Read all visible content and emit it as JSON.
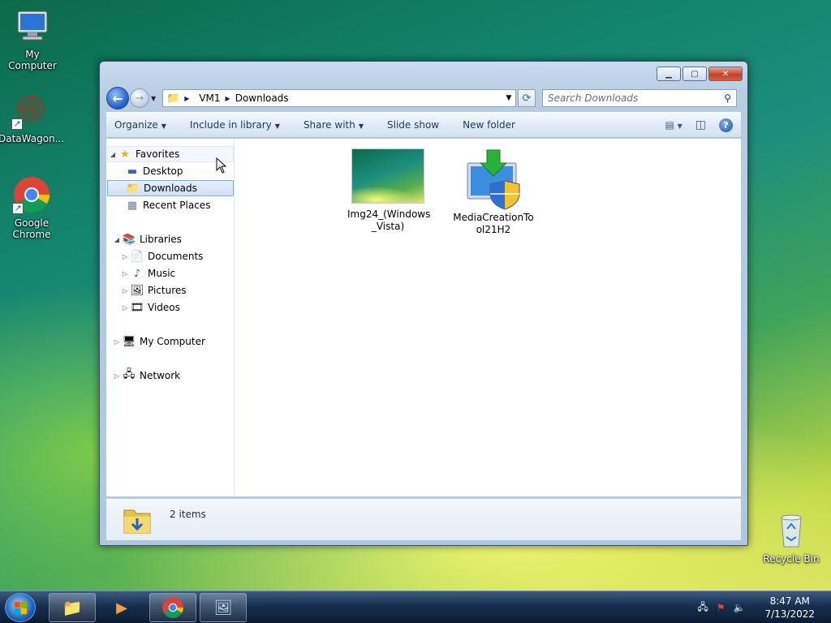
{
  "desktop": {
    "icons": [
      {
        "label": "My Computer"
      },
      {
        "label": "DataWagon..."
      },
      {
        "label": "Google Chrome"
      },
      {
        "label": "Recycle Bin"
      }
    ]
  },
  "window": {
    "address": {
      "segments": [
        "VM1",
        "Downloads"
      ]
    },
    "search": {
      "placeholder": "Search Downloads"
    },
    "toolbar": {
      "organize": "Organize",
      "include_in_library": "Include in library",
      "share_with": "Share with",
      "slide_show": "Slide show",
      "new_folder": "New folder"
    },
    "nav": {
      "favorites": "Favorites",
      "desktop": "Desktop",
      "downloads": "Downloads",
      "recent_places": "Recent Places",
      "libraries": "Libraries",
      "documents": "Documents",
      "music": "Music",
      "pictures": "Pictures",
      "videos": "Videos",
      "my_computer": "My Computer",
      "network": "Network"
    },
    "files": [
      {
        "name_line1": "Img24_(Windows",
        "name_line2": "_Vista)"
      },
      {
        "name_line1": "MediaCreationTo",
        "name_line2": "ol21H2"
      }
    ],
    "details": {
      "count": "2 items"
    }
  },
  "taskbar": {
    "clock_time": "8:47 AM",
    "clock_date": "7/13/2022"
  },
  "colors": {
    "accent": "#1b5cc8",
    "selection": "#cfe1f7",
    "close": "#c7432c"
  }
}
